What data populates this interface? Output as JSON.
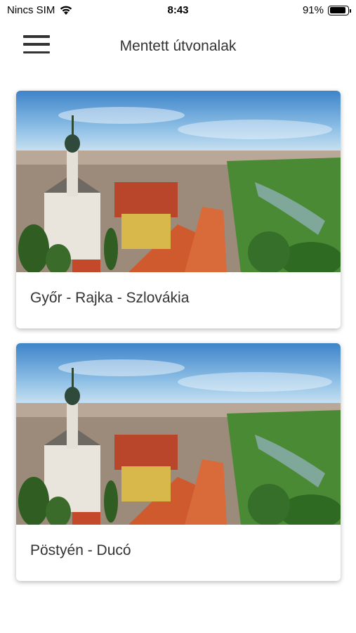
{
  "status_bar": {
    "carrier": "Nincs SIM",
    "time": "8:43",
    "battery_percent_text": "91%",
    "battery_level": 0.91,
    "icons": [
      "wifi-icon",
      "battery-icon"
    ]
  },
  "header": {
    "menu_icon": "hamburger-menu-icon",
    "title": "Mentett útvonalak"
  },
  "routes": [
    {
      "name": "Győr - Rajka - Szlovákia",
      "image": "aerial-town-panorama"
    },
    {
      "name": "Pöstyén - Ducó",
      "image": "aerial-town-panorama"
    }
  ],
  "colors": {
    "text": "#333333",
    "background": "#ffffff",
    "sky": "#4a90d0",
    "roof": "#c0502e",
    "greenery": "#3f7a2e"
  }
}
